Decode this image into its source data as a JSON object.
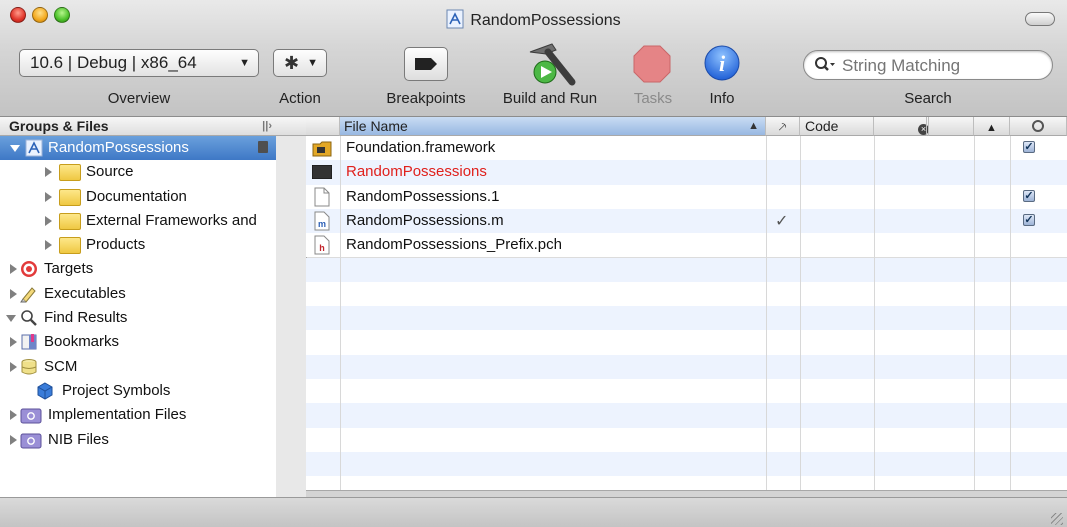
{
  "window": {
    "title": "RandomPossessions"
  },
  "toolbar": {
    "overview_value": "10.6 | Debug | x86_64",
    "overview_label": "Overview",
    "action_label": "Action",
    "breakpoints_label": "Breakpoints",
    "build_run_label": "Build and Run",
    "tasks_label": "Tasks",
    "info_label": "Info",
    "search_placeholder": "String Matching",
    "search_label": "Search"
  },
  "sidebar": {
    "header": "Groups & Files",
    "items": [
      {
        "label": "RandomPossessions"
      },
      {
        "label": "Source"
      },
      {
        "label": "Documentation"
      },
      {
        "label": "External Frameworks and"
      },
      {
        "label": "Products"
      },
      {
        "label": "Targets"
      },
      {
        "label": "Executables"
      },
      {
        "label": "Find Results"
      },
      {
        "label": "Bookmarks"
      },
      {
        "label": "SCM"
      },
      {
        "label": "Project Symbols"
      },
      {
        "label": "Implementation Files"
      },
      {
        "label": "NIB Files"
      }
    ]
  },
  "table": {
    "columns": {
      "file_name": "File Name",
      "code": "Code"
    },
    "rows": [
      {
        "name": "Foundation.framework",
        "icon": "framework-icon",
        "target": true
      },
      {
        "name": "RandomPossessions",
        "icon": "executable-icon",
        "missing": true,
        "color": "#e0201c"
      },
      {
        "name": "RandomPossessions.1",
        "icon": "document-icon",
        "target": true
      },
      {
        "name": "RandomPossessions.m",
        "icon": "m-file-icon",
        "built": true,
        "target": true
      },
      {
        "name": "RandomPossessions_Prefix.pch",
        "icon": "h-file-icon"
      }
    ]
  },
  "colors": {
    "selection": "#3e78c6",
    "missing_file": "#e0201c",
    "row_stripe": "#edf3fe"
  }
}
